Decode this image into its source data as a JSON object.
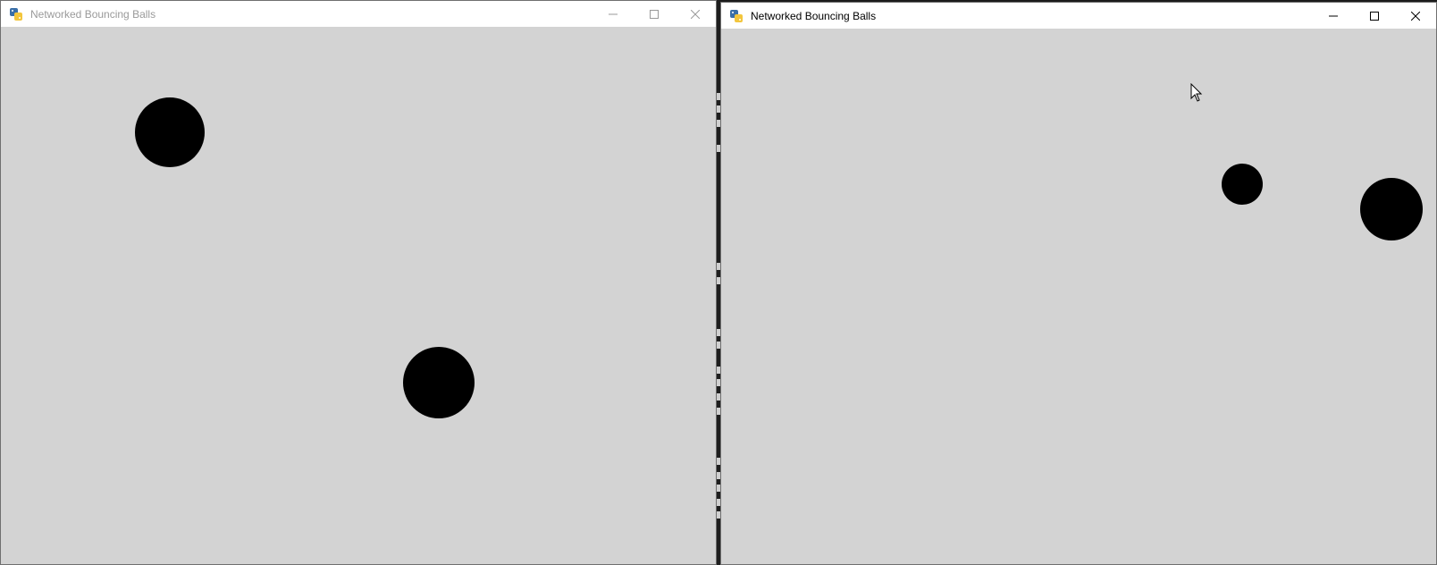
{
  "windows": [
    {
      "id": "left",
      "title": "Networked Bouncing Balls",
      "focused": false,
      "app_icon": "python-icon",
      "controls": [
        "minimize-icon",
        "maximize-icon",
        "close-icon"
      ]
    },
    {
      "id": "right",
      "title": "Networked Bouncing Balls",
      "focused": true,
      "app_icon": "python-icon",
      "controls": [
        "minimize-icon",
        "maximize-icon",
        "close-icon"
      ]
    }
  ],
  "colors": {
    "canvas_background": "#d3d3d3",
    "ball": "#000000",
    "titlebar": "#ffffff",
    "inactive_title": "#9a9a9a"
  },
  "pointer": "mouse-pointer-icon"
}
